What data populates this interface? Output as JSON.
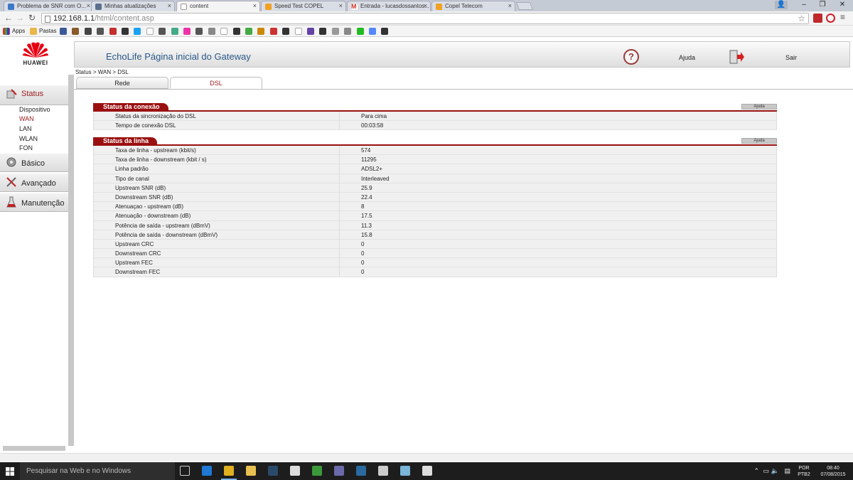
{
  "browser": {
    "tabs": [
      {
        "label": "Problema de SNR com O...",
        "color": "#3b79c8"
      },
      {
        "label": "Minhas atualizações",
        "color": "#5a6f8c"
      },
      {
        "label": "content",
        "color": "#bbbbbb"
      },
      {
        "label": "Speed Test COPEL",
        "color": "#f2a020"
      },
      {
        "label": "Entrada - lucasdossantos...",
        "color": "#d93025"
      },
      {
        "label": "Copel Telecom",
        "color": "#f2a020"
      }
    ],
    "active_tab_index": 2,
    "address": {
      "host": "192.168.1.1",
      "path": "/html/content.asp"
    },
    "bookmarks": {
      "apps_label": "Apps",
      "folder_label": "Pastas"
    }
  },
  "router": {
    "brand": "HUAWEI",
    "title": "EchoLife Página inicial do Gateway",
    "help_label": "Ajuda",
    "exit_label": "Sair",
    "breadcrumb": "Status > WAN > DSL",
    "subtabs": [
      "Rede",
      "DSL"
    ],
    "active_subtab": "DSL",
    "menu": [
      {
        "label": "Status",
        "active": true,
        "submenu": [
          "Dispositivo",
          "WAN",
          "LAN",
          "WLAN",
          "FON"
        ],
        "active_sub": "WAN"
      },
      {
        "label": "Básico"
      },
      {
        "label": "Avançado"
      },
      {
        "label": "Manutenção"
      }
    ],
    "connection_section": {
      "title": "Status da conexão",
      "help": "Ajuda",
      "rows": [
        {
          "label": "Status da sincronização do DSL",
          "value": "Para cima"
        },
        {
          "label": "Tempo de conexão DSL",
          "value": "00:03:58"
        }
      ]
    },
    "line_section": {
      "title": "Status da linha",
      "help": "Ajuda",
      "rows": [
        {
          "label": "Taxa de linha - upstream (kbit/s)",
          "value": "574"
        },
        {
          "label": "Taxa de linha - downstream (kbit / s)",
          "value": "11295"
        },
        {
          "label": "Linha padrão",
          "value": "ADSL2+"
        },
        {
          "label": "Tipo de canal",
          "value": "Interleaved"
        },
        {
          "label": "Upstream SNR (dB)",
          "value": "25.9"
        },
        {
          "label": "Downstream SNR (dB)",
          "value": "22.4"
        },
        {
          "label": "Atenuaçao - upstream (dB)",
          "value": "8"
        },
        {
          "label": "Atenuação - downstream (dB)",
          "value": "17.5"
        },
        {
          "label": "Potência de saída - upstream (dBmV)",
          "value": "11.3"
        },
        {
          "label": "Potência de saída - downstream (dBmV)",
          "value": "15.8"
        },
        {
          "label": "Upstream CRC",
          "value": "0"
        },
        {
          "label": "Downstream CRC",
          "value": "0"
        },
        {
          "label": "Upstream FEC",
          "value": "0"
        },
        {
          "label": "Downstream FEC",
          "value": "0"
        }
      ]
    }
  },
  "taskbar": {
    "search_placeholder": "Pesquisar na Web e no Windows",
    "lang_top": "POR",
    "lang_bottom": "PTB2",
    "time": "08:40",
    "date": "07/08/2015"
  },
  "colors": {
    "accent": "#9a1010",
    "brand": "#e60012",
    "title": "#2a5a8a"
  }
}
